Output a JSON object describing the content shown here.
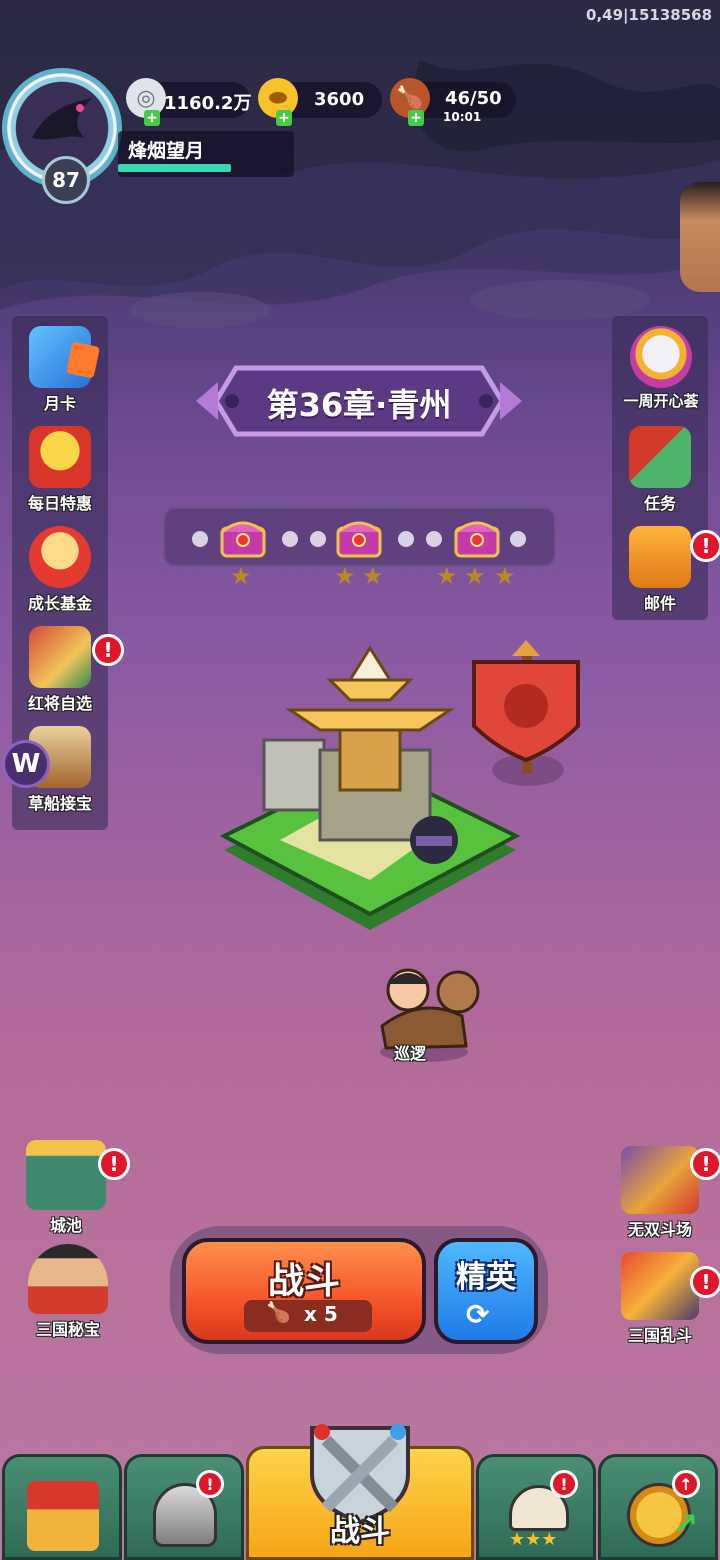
{
  "debug_text": "0,49|15138568",
  "player": {
    "name": "烽烟望月",
    "level": "87",
    "exp_fraction": 0.64
  },
  "resources": {
    "silver": {
      "icon": "silver-coin-icon",
      "value": "1160.2万"
    },
    "gold": {
      "icon": "gold-ingot-icon",
      "value": "3600"
    },
    "stamina": {
      "icon": "meat-icon",
      "value": "46/50",
      "timer": "10:01"
    }
  },
  "left_menu": [
    {
      "label": "月卡",
      "icon": "month-card-icon",
      "alert": false
    },
    {
      "label": "每日特惠",
      "icon": "daily-deal-icon",
      "alert": false
    },
    {
      "label": "成长基金",
      "icon": "growth-fund-icon",
      "alert": false
    },
    {
      "label": "红将自选",
      "icon": "red-general-icon",
      "alert": true
    },
    {
      "label": "草船接宝",
      "icon": "straw-boat-icon",
      "alert": false
    }
  ],
  "right_menu": [
    {
      "label": "一周开心荟",
      "icon": "weekly-event-icon",
      "alert": false
    },
    {
      "label": "任务",
      "icon": "quest-scroll-icon",
      "alert": false
    },
    {
      "label": "邮件",
      "icon": "mail-icon",
      "alert": true
    }
  ],
  "chapter": {
    "title": "第36章·青州"
  },
  "chapter_progress": {
    "chests": [
      {
        "stars": 1
      },
      {
        "stars": 2
      },
      {
        "stars": 3
      }
    ],
    "alert_symbol": "!"
  },
  "stage": {
    "patrol_label": "巡逻"
  },
  "bottom_left": [
    {
      "label": "城池",
      "icon": "city-icon",
      "alert": true
    },
    {
      "label": "三国秘宝",
      "icon": "treasure-icon",
      "alert": false
    }
  ],
  "bottom_right": [
    {
      "label": "无双斗场",
      "icon": "arena-icon",
      "alert": true
    },
    {
      "label": "三国乱斗",
      "icon": "brawl-icon",
      "alert": true
    }
  ],
  "battle": {
    "fight_label": "战斗",
    "cost_text": "x 5",
    "elite_label": "精英"
  },
  "nav": {
    "center_label": "战斗"
  },
  "colors": {
    "alert": "#e0172b",
    "fight": "#f4562c",
    "elite": "#1f7be8",
    "nav": "#2f6a55",
    "nav_active": "#f5a516"
  }
}
